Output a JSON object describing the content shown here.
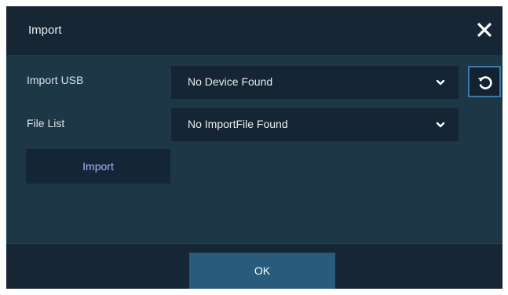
{
  "dialog": {
    "title": "Import",
    "close_icon": "close-icon"
  },
  "form": {
    "import_usb": {
      "label": "Import USB",
      "value": "No Device Found",
      "dropdown_icon": "chevron-down-icon"
    },
    "refresh_icon": "refresh-icon",
    "file_list": {
      "label": "File List",
      "value": "No ImportFile Found",
      "dropdown_icon": "chevron-down-icon"
    },
    "import_button": "Import"
  },
  "footer": {
    "ok_label": "OK"
  },
  "colors": {
    "background": "#1d3747",
    "titlebar": "#162634",
    "select_bg": "#152534",
    "ok_button": "#295b7c",
    "refresh_border": "#3b78a6",
    "import_text": "#a9b5ff"
  }
}
